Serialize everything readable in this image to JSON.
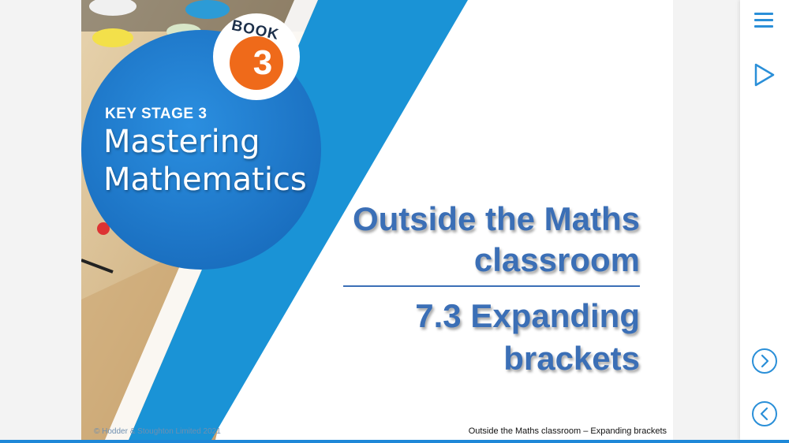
{
  "colors": {
    "accent_blue": "#1e88d8",
    "heading_blue": "#3b6fb6",
    "circle_blue": "#1f7fd1",
    "book_orange": "#ef6a1a"
  },
  "cover": {
    "book_label": "BOOK",
    "book_number": "3",
    "key_stage": "KEY STAGE 3",
    "series_title_line1": "Mastering",
    "series_title_line2": "Mathematics"
  },
  "slide": {
    "title": "Outside the Maths classroom",
    "subtitle": "7.3 Expanding brackets",
    "copyright": "© Hodder & Stoughton Limited 2021",
    "footer_title": "Outside the Maths classroom – Expanding brackets"
  },
  "side_panel": {
    "menu_icon": "hamburger-menu-icon",
    "play_icon": "play-icon",
    "next_icon": "chevron-right-circle-icon",
    "prev_icon": "chevron-left-circle-icon"
  }
}
